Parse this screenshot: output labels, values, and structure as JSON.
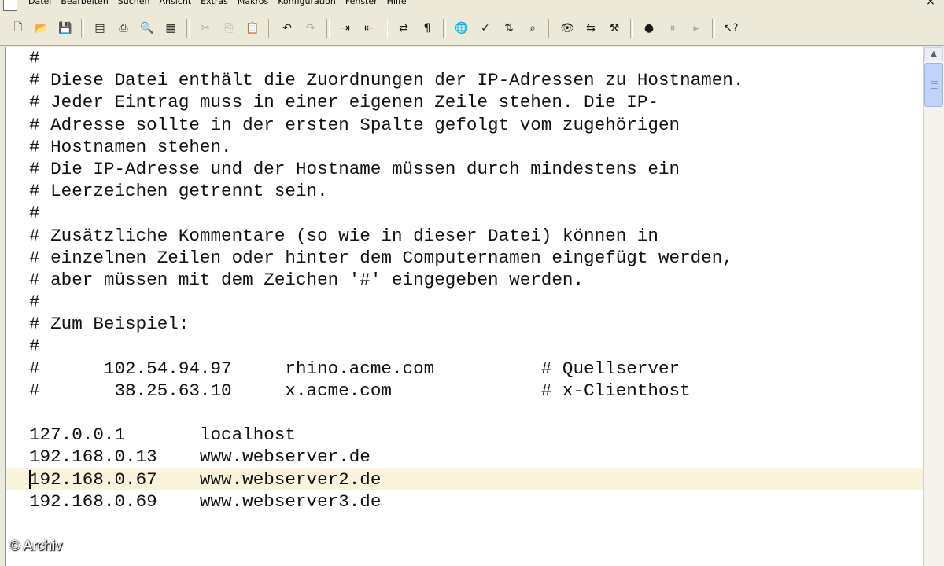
{
  "menubar": {
    "items": [
      "Datei",
      "Bearbeiten",
      "Suchen",
      "Ansicht",
      "Extras",
      "Makros",
      "Konfiguration",
      "Fenster",
      "Hilfe"
    ],
    "close_symbol": "×"
  },
  "toolbar": {
    "buttons": [
      {
        "name": "new-file-icon",
        "glyph": "🗋"
      },
      {
        "name": "open-folder-icon",
        "glyph": "📂"
      },
      {
        "name": "save-icon",
        "glyph": "💾"
      },
      {
        "sep": true
      },
      {
        "name": "document-icon",
        "glyph": "▤"
      },
      {
        "name": "print-icon",
        "glyph": "⎙"
      },
      {
        "name": "print-preview-icon",
        "glyph": "🔍"
      },
      {
        "name": "properties-icon",
        "glyph": "▦"
      },
      {
        "sep": true
      },
      {
        "name": "cut-icon",
        "glyph": "✂",
        "disabled": true
      },
      {
        "name": "copy-icon",
        "glyph": "⎘",
        "disabled": true
      },
      {
        "name": "paste-icon",
        "glyph": "📋"
      },
      {
        "sep": true
      },
      {
        "name": "undo-icon",
        "glyph": "↶"
      },
      {
        "name": "redo-icon",
        "glyph": "↷",
        "disabled": true
      },
      {
        "sep": true
      },
      {
        "name": "indent-icon",
        "glyph": "⇥"
      },
      {
        "name": "outdent-icon",
        "glyph": "⇤"
      },
      {
        "sep": true
      },
      {
        "name": "word-wrap-icon",
        "glyph": "⇄"
      },
      {
        "name": "pilcrow-icon",
        "glyph": "¶"
      },
      {
        "sep": true
      },
      {
        "name": "web-icon",
        "glyph": "🌐"
      },
      {
        "name": "spellcheck-icon",
        "glyph": "✓"
      },
      {
        "name": "sort-icon",
        "glyph": "⇅"
      },
      {
        "name": "find-icon",
        "glyph": "⌕"
      },
      {
        "sep": true
      },
      {
        "name": "view-icon",
        "glyph": "👁"
      },
      {
        "name": "replace-icon",
        "glyph": "⇆"
      },
      {
        "name": "tools-icon",
        "glyph": "⚒"
      },
      {
        "sep": true
      },
      {
        "name": "record-macro-icon",
        "glyph": "●"
      },
      {
        "name": "pause-macro-icon",
        "glyph": "⏸",
        "disabled": true
      },
      {
        "name": "play-macro-icon",
        "glyph": "▸",
        "disabled": true
      },
      {
        "sep": true
      },
      {
        "name": "help-icon",
        "glyph": "↖?"
      }
    ]
  },
  "editor": {
    "lines": [
      "#",
      "# Diese Datei enthält die Zuordnungen der IP-Adressen zu Hostnamen.",
      "# Jeder Eintrag muss in einer eigenen Zeile stehen. Die IP-",
      "# Adresse sollte in der ersten Spalte gefolgt vom zugehörigen",
      "# Hostnamen stehen.",
      "# Die IP-Adresse und der Hostname müssen durch mindestens ein",
      "# Leerzeichen getrennt sein.",
      "#",
      "# Zusätzliche Kommentare (so wie in dieser Datei) können in",
      "# einzelnen Zeilen oder hinter dem Computernamen eingefügt werden,",
      "# aber müssen mit dem Zeichen '#' eingegeben werden.",
      "#",
      "# Zum Beispiel:",
      "#",
      "#      102.54.94.97     rhino.acme.com          # Quellserver",
      "#       38.25.63.10     x.acme.com              # x-Clienthost",
      "",
      "127.0.0.1       localhost",
      "192.168.0.13    www.webserver.de",
      "192.168.0.67    www.webserver2.de",
      "192.168.0.69    www.webserver3.de"
    ]
  },
  "watermark": "© Archiv"
}
